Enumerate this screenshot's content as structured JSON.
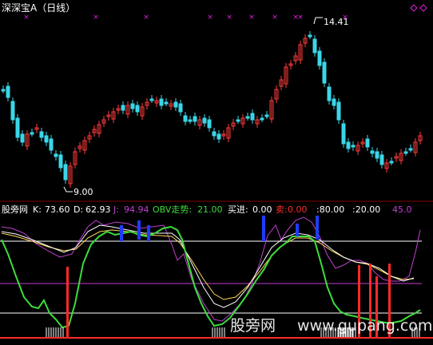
{
  "window_title": "深深宝A（日线）",
  "price_panel": {
    "high_label": "14.41",
    "low_label": "9.00",
    "colors": {
      "up": "#ff3b3b",
      "down": "#3ad6e8",
      "marker": "#e01fe0"
    }
  },
  "indicator_panel": {
    "name": "股旁网",
    "k_label": "K:",
    "k_value": "73.60",
    "d_label": "D:",
    "d_value": "62.93",
    "j_label": "J:",
    "j_value": "94.94",
    "obv_label": "OBV走势:",
    "obv_value": "21.00",
    "buyin_label": "买进:",
    "buyin_value": "0.00",
    "sell_label": "卖:",
    "sell_value": "0.00",
    "level80": ":80.00",
    "level20": ":20.00",
    "level45": "45.0",
    "colors": {
      "k": "#ffffff",
      "d": "#ffd75a",
      "j": "#c040d0",
      "obv": "#3ddc3d",
      "buy": "#ff2a2a",
      "bar": "#1f3cff"
    }
  },
  "watermark": {
    "cn": "股旁网",
    "url": "www.gupang.com"
  }
}
